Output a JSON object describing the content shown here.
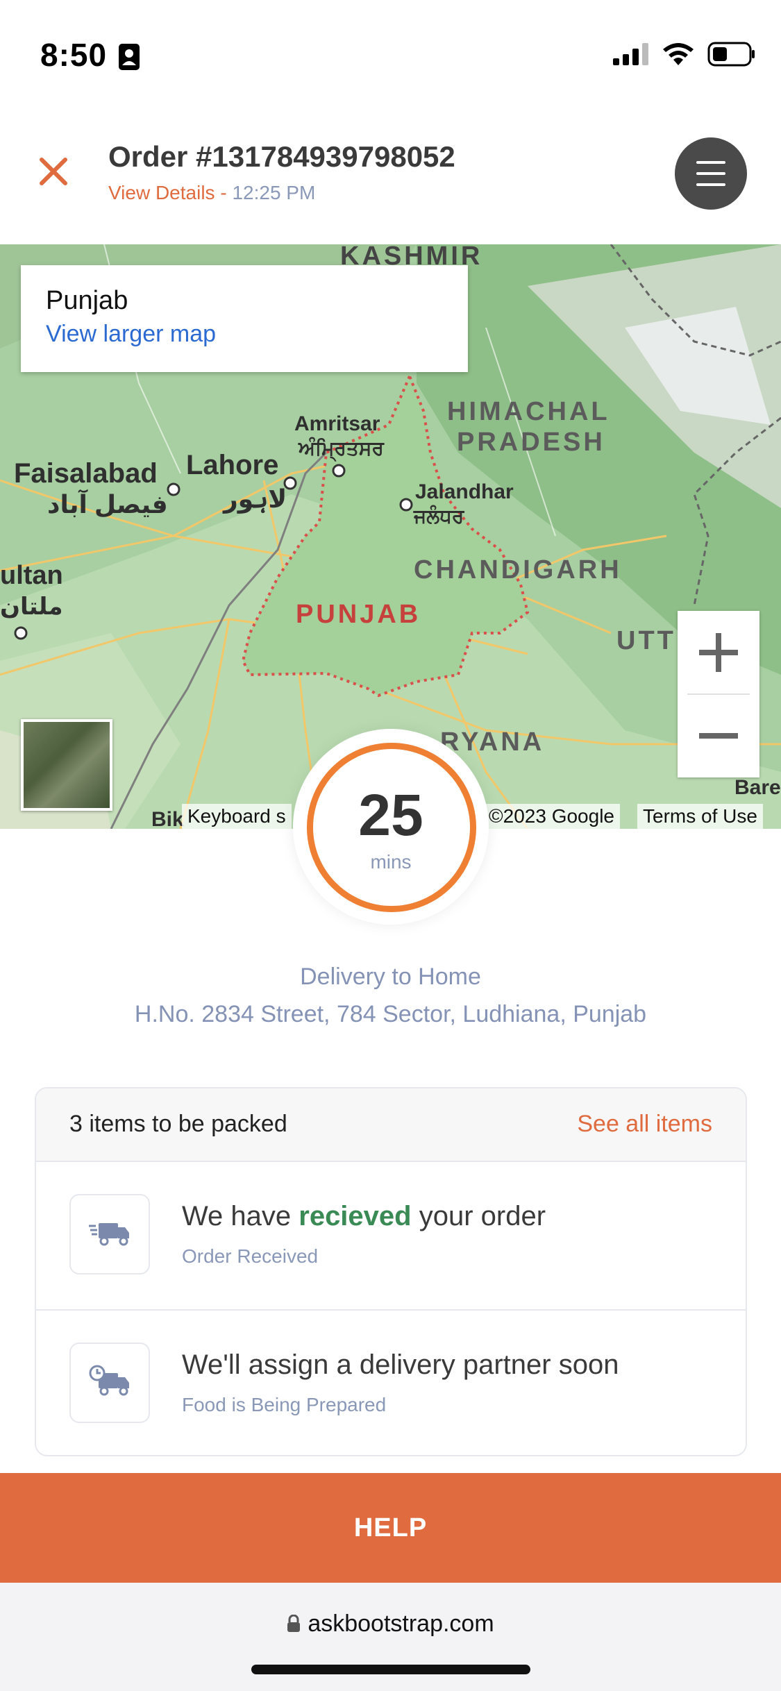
{
  "status_bar": {
    "time": "8:50"
  },
  "header": {
    "order_title": "Order #131784939798052",
    "view_details": "View Details",
    "separator": " - ",
    "order_time": "12:25 PM"
  },
  "map": {
    "card_title": "Punjab",
    "card_link": "View larger map",
    "labels": {
      "kashmir": "KASHMIR",
      "himachal_1": "HIMACHAL",
      "himachal_2": "PRADESH",
      "amritsar": "Amritsar",
      "amritsar_local": "ਅੰਮ੍ਰਿਤਸਰ",
      "lahore": "Lahore",
      "lahore_local": "لاہور",
      "faisalabad": "Faisalabad",
      "faisalabad_local": "فیصل آباد",
      "multan": "ultan",
      "multan_local": "ملتان",
      "jalandhar": "Jalandhar",
      "jalandhar_local": "ਜਲੰਧਰ",
      "chandigarh": "CHANDIGARH",
      "punjab": "PUNJAB",
      "uttar": "UTT",
      "haryana": "RYANA",
      "bikaner": "Bik",
      "bareilly": "Bare"
    },
    "attribution": {
      "keyboard": "Keyboard s",
      "copyright": "©2023 Google",
      "terms": "Terms of Use"
    }
  },
  "timer": {
    "value": "25",
    "unit": "mins"
  },
  "delivery": {
    "label": "Delivery to Home",
    "address": "H.No. 2834 Street, 784 Sector, Ludhiana, Punjab"
  },
  "items_card": {
    "count_label": "3 items to be packed",
    "see_all": "See all items",
    "steps": [
      {
        "pre": "We have ",
        "highlight": "recieved",
        "post": " your order",
        "sub": "Order Received",
        "icon": "delivery-truck-icon"
      },
      {
        "text": "We'll assign a delivery partner soon",
        "sub": "Food is Being Prepared",
        "icon": "scheduled-truck-icon"
      }
    ]
  },
  "help_label": "HELP",
  "url": "askbootstrap.com",
  "colors": {
    "accent": "#e06b3e",
    "timer_ring": "#ee7f33",
    "success": "#3a8a55",
    "muted": "#8a98b8"
  }
}
